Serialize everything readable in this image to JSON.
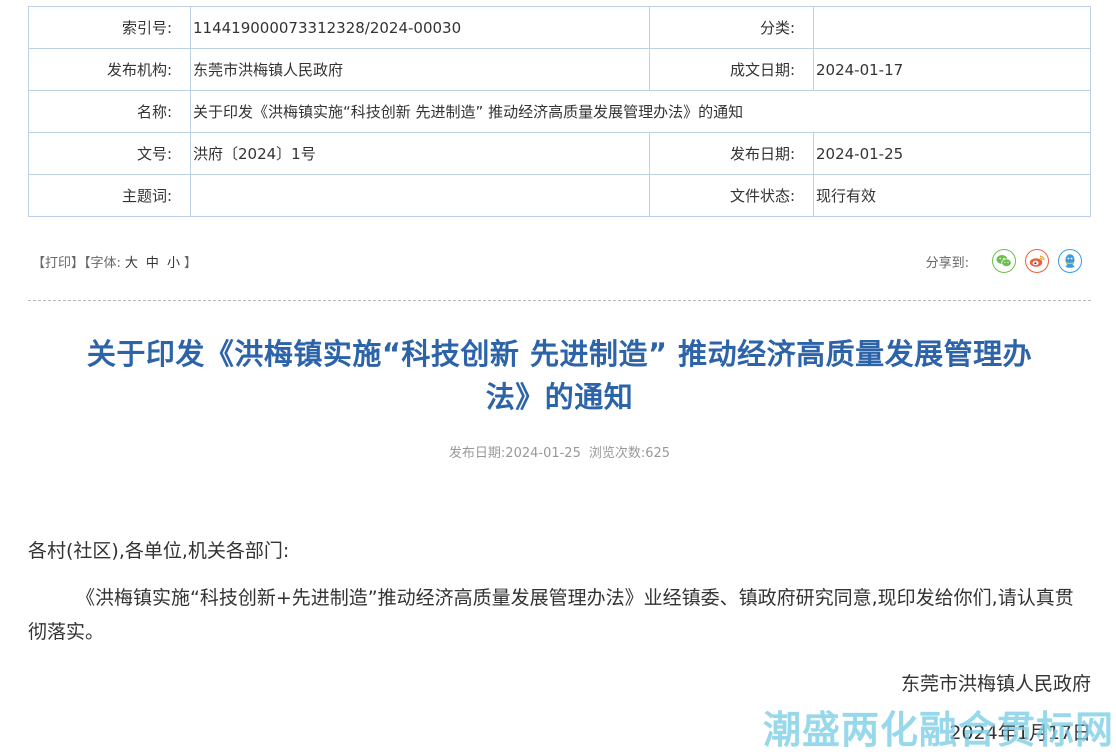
{
  "meta": {
    "index_label": "索引号:",
    "index_value": "114419000073312328/2024-00030",
    "category_label": "分类:",
    "category_value": "",
    "publisher_label": "发布机构:",
    "publisher_value": "东莞市洪梅镇人民政府",
    "created_label": "成文日期:",
    "created_value": "2024-01-17",
    "name_label": "名称:",
    "name_value": "关于印发《洪梅镇实施“科技创新 先进制造” 推动经济高质量发展管理办法》的通知",
    "docno_label": "文号:",
    "docno_value": "洪府〔2024〕1号",
    "published_label": "发布日期:",
    "published_value": "2024-01-25",
    "keywords_label": "主题词:",
    "keywords_value": "",
    "status_label": "文件状态:",
    "status_value": "现行有效"
  },
  "toolbar": {
    "print": "【打印】",
    "font_prefix": "【字体:",
    "font_large": "大",
    "font_medium": "中",
    "font_small": "小",
    "font_suffix": "】"
  },
  "share": {
    "label": "分享到:",
    "icons": [
      "wechat-icon",
      "weibo-icon",
      "qq-icon"
    ],
    "colors": {
      "wechat": "#6bbf4b",
      "weibo": "#e8623a",
      "qq": "#3b9be0"
    }
  },
  "article": {
    "title_line1": "关于印发《洪梅镇实施“科技创新 先进制造” 推动经济高质量发展管理办",
    "title_line2": "法》的通知",
    "pub_date": "发布日期:2024-01-25",
    "views": "浏览次数:625",
    "salutation": "各村(社区),各单位,机关各部门:",
    "paragraph": "《洪梅镇实施“科技创新+先进制造”推动经济高质量发展管理办法》业经镇委、镇政府研究同意,现印发给你们,请认真贯彻落实。",
    "signature": "东莞市洪梅镇人民政府",
    "sign_date": "2024年1月17日"
  },
  "watermark": "潮盛两化融合贯标网",
  "colors": {
    "title": "#2d63a8",
    "table_border": "#bcd0e6",
    "watermark": "#7acde6"
  }
}
